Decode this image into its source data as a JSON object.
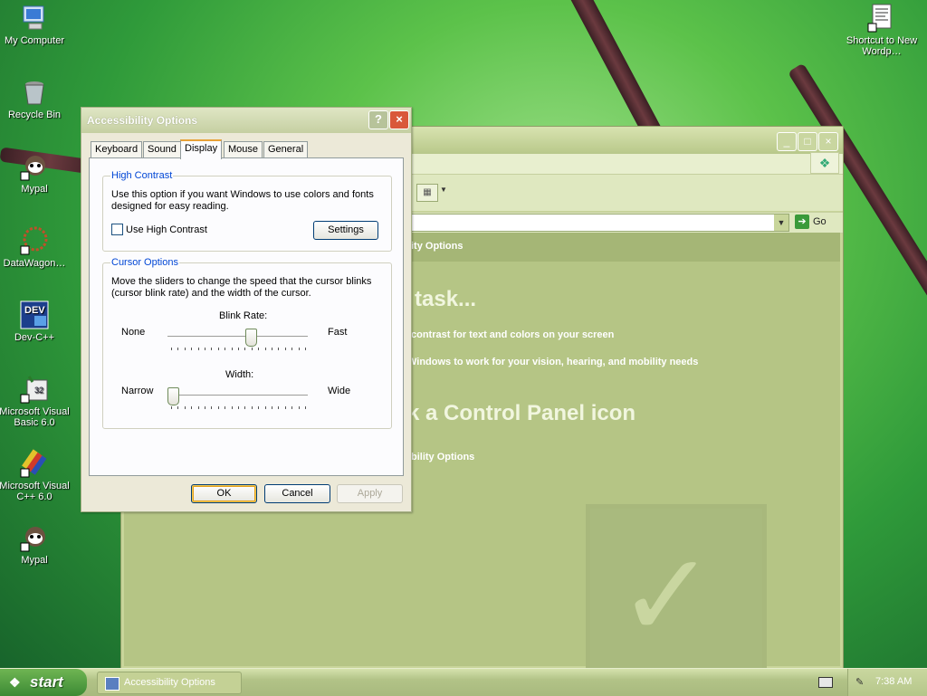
{
  "desktop_icons": [
    {
      "label": "My Computer",
      "icon": "my-computer-icon"
    },
    {
      "label": "Recycle Bin",
      "icon": "recycle-bin-icon"
    },
    {
      "label": "Mypal",
      "icon": "mypal-icon"
    },
    {
      "label": "DataWagon…",
      "icon": "datawagon-icon"
    },
    {
      "label": "Dev-C++",
      "icon": "dev-cpp-icon"
    },
    {
      "label": "Microsoft Visual Basic 6.0",
      "icon": "visual-basic-icon"
    },
    {
      "label": "Microsoft Visual C++ 6.0",
      "icon": "visual-cpp-icon"
    },
    {
      "label": "Mypal",
      "icon": "mypal-icon"
    },
    {
      "label": "Shortcut to New Wordp…",
      "icon": "wordpad-document-icon"
    }
  ],
  "control_panel": {
    "header": "ity Options",
    "heading1": "task...",
    "link1": "contrast for text and colors on your screen",
    "link2": "Windows to work for your vision, hearing, and mobility needs",
    "heading2": "k a Control Panel icon",
    "link3": "bility Options",
    "go_label": "Go"
  },
  "dialog": {
    "title": "Accessibility Options",
    "help_button": "?",
    "close_button": "×",
    "tabs": [
      "Keyboard",
      "Sound",
      "Display",
      "Mouse",
      "General"
    ],
    "active_tab": "Display",
    "high_contrast": {
      "legend": "High Contrast",
      "description": "Use this option if you want Windows to use colors and fonts designed for easy reading.",
      "checkbox_label": "Use High Contrast",
      "checked": false,
      "settings_button": "Settings"
    },
    "cursor_options": {
      "legend": "Cursor Options",
      "description": "Move the sliders to change the speed that the cursor blinks (cursor blink rate) and the width of the cursor.",
      "blink_rate": {
        "label": "Blink Rate:",
        "min_label": "None",
        "max_label": "Fast",
        "value": 0.6
      },
      "width": {
        "label": "Width:",
        "min_label": "Narrow",
        "max_label": "Wide",
        "value": 0.0
      }
    },
    "buttons": {
      "ok": "OK",
      "cancel": "Cancel",
      "apply": "Apply"
    }
  },
  "taskbar": {
    "start_label": "start",
    "task_label": "Accessibility Options",
    "clock": "7:38 AM"
  }
}
